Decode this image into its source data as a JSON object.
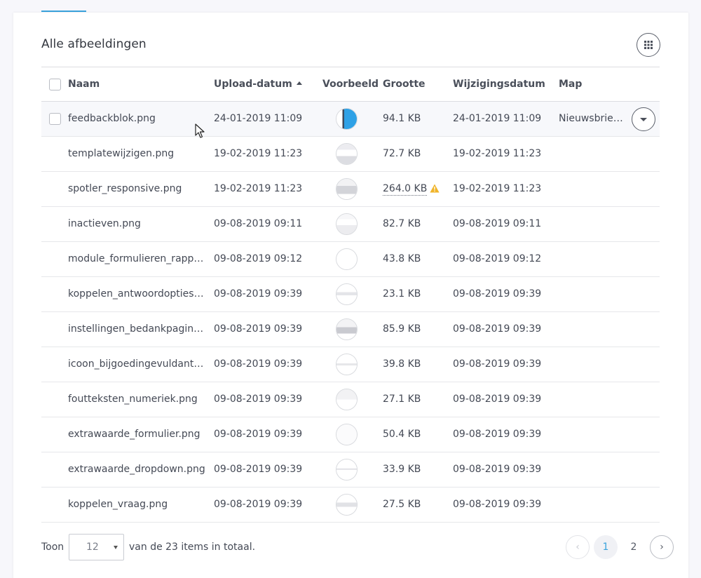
{
  "card": {
    "title": "Alle afbeeldingen",
    "view_toggle_icon": "grid-icon"
  },
  "table": {
    "headers": {
      "name": "Naam",
      "upload_date": "Upload-datum",
      "preview": "Voorbeeld",
      "size": "Grootte",
      "modified": "Wijzigingsdatum",
      "folder": "Map"
    },
    "sort": {
      "column": "upload_date",
      "direction": "ascending"
    },
    "rows": [
      {
        "name": "feedbackblok.png",
        "upload": "24-01-2019 11:09",
        "size": "94.1 KB",
        "modified": "24-01-2019 11:09",
        "folder": "Nieuwsbrief…"
      },
      {
        "name": "templatewijzigen.png",
        "upload": "19-02-2019 11:23",
        "size": "72.7 KB",
        "modified": "19-02-2019 11:23",
        "folder": ""
      },
      {
        "name": "spotler_responsive.png",
        "upload": "19-02-2019 11:23",
        "size": "264.0 KB",
        "modified": "19-02-2019 11:23",
        "folder": ""
      },
      {
        "name": "inactieven.png",
        "upload": "09-08-2019 09:11",
        "size": "82.7 KB",
        "modified": "09-08-2019 09:11",
        "folder": ""
      },
      {
        "name": "module_formulieren_rappo…",
        "upload": "09-08-2019 09:12",
        "size": "43.8 KB",
        "modified": "09-08-2019 09:12",
        "folder": ""
      },
      {
        "name": "koppelen_antwoordopties.p…",
        "upload": "09-08-2019 09:39",
        "size": "23.1 KB",
        "modified": "09-08-2019 09:39",
        "folder": ""
      },
      {
        "name": "instellingen_bedankpagina.…",
        "upload": "09-08-2019 09:39",
        "size": "85.9 KB",
        "modified": "09-08-2019 09:39",
        "folder": ""
      },
      {
        "name": "icoon_bijgoedingevuldantw…",
        "upload": "09-08-2019 09:39",
        "size": "39.8 KB",
        "modified": "09-08-2019 09:39",
        "folder": ""
      },
      {
        "name": "foutteksten_numeriek.png",
        "upload": "09-08-2019 09:39",
        "size": "27.1 KB",
        "modified": "09-08-2019 09:39",
        "folder": ""
      },
      {
        "name": "extrawaarde_formulier.png",
        "upload": "09-08-2019 09:39",
        "size": "50.4 KB",
        "modified": "09-08-2019 09:39",
        "folder": ""
      },
      {
        "name": "extrawaarde_dropdown.png",
        "upload": "09-08-2019 09:39",
        "size": "33.9 KB",
        "modified": "09-08-2019 09:39",
        "folder": ""
      },
      {
        "name": "koppelen_vraag.png",
        "upload": "09-08-2019 09:39",
        "size": "27.5 KB",
        "modified": "09-08-2019 09:39",
        "folder": ""
      }
    ]
  },
  "footer": {
    "show_label": "Toon",
    "page_size": "12",
    "total_text": "van de 23 items in totaal.",
    "pages": [
      "1",
      "2"
    ],
    "current_page": "1",
    "prev_icon": "‹",
    "next_icon": "›"
  },
  "colors": {
    "accent": "#3aa3dc",
    "warning": "#f0b429"
  }
}
